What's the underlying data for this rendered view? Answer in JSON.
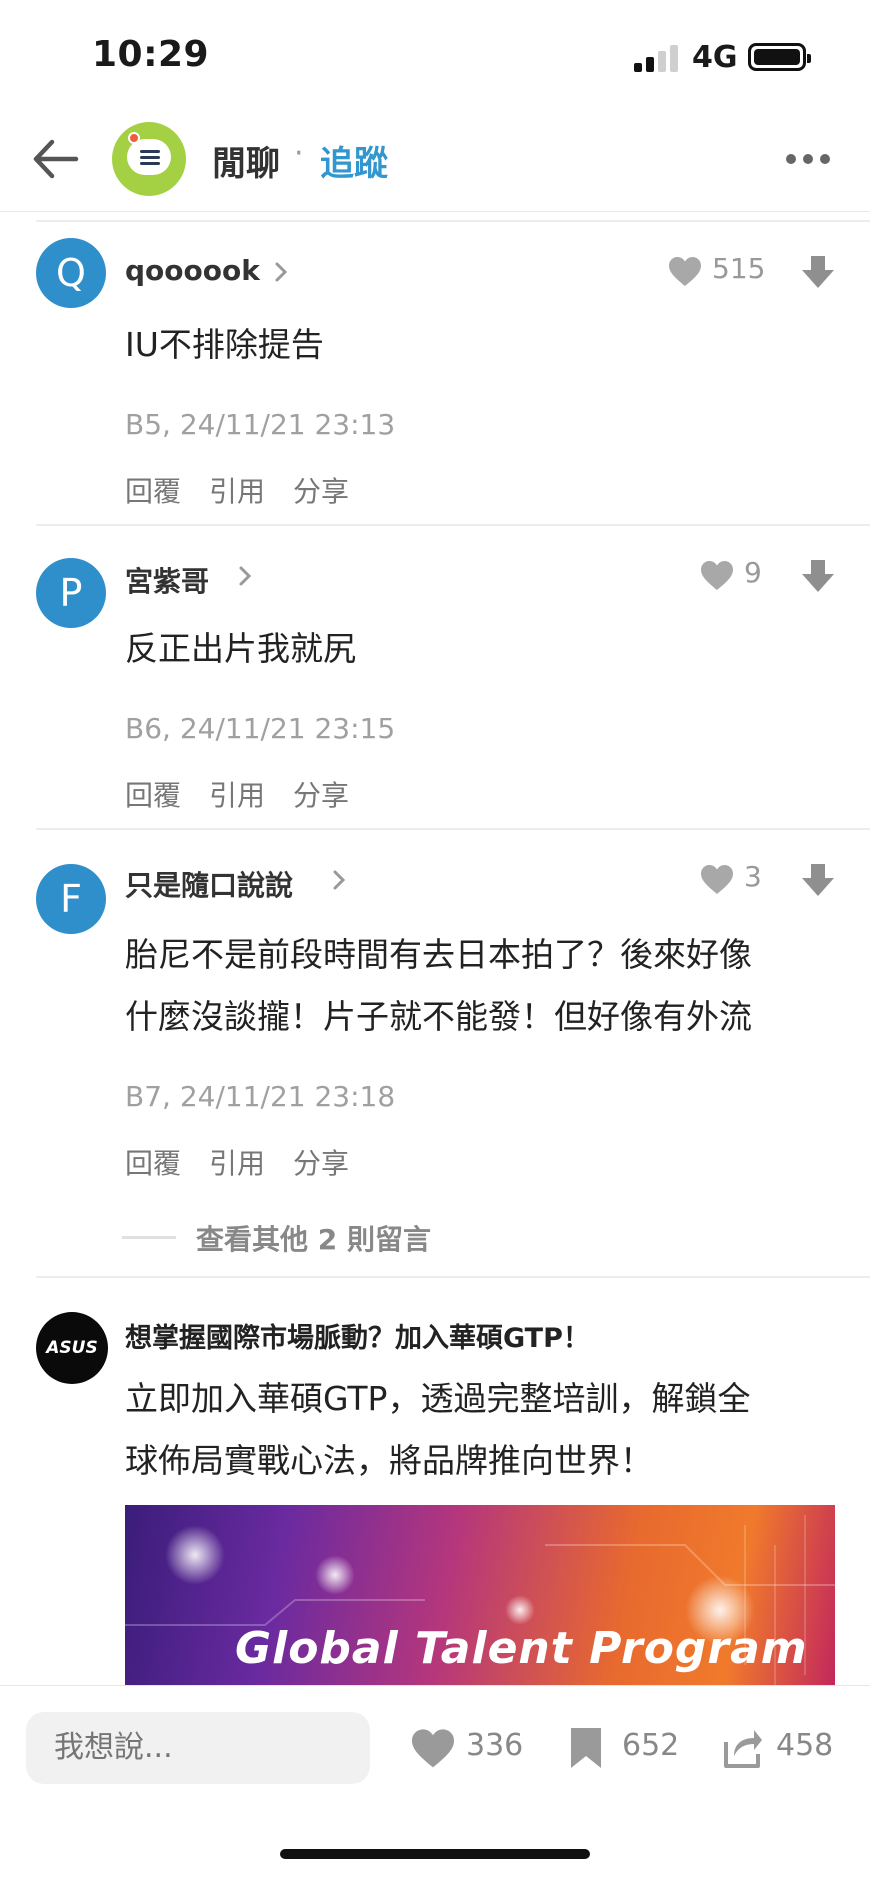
{
  "status_bar": {
    "time": "10:29",
    "network": "4G"
  },
  "header": {
    "board_name": "閒聊",
    "separator": "·",
    "follow_label": "追蹤"
  },
  "comments": [
    {
      "avatar_letter": "Q",
      "username": "qoooook",
      "likes": "515",
      "content_lines": [
        "IU不排除提告"
      ],
      "meta": "B5, 24/11/21 23:13"
    },
    {
      "avatar_letter": "P",
      "username": "宮紫哥",
      "likes": "9",
      "content_lines": [
        "反正出片我就尻"
      ],
      "meta": "B6, 24/11/21 23:15"
    },
    {
      "avatar_letter": "F",
      "username": "只是隨口說說",
      "likes": "3",
      "content_lines": [
        "胎尼不是前段時間有去日本拍了？後來好像",
        "什麼沒談攏！片子就不能發！但好像有外流"
      ],
      "meta": "B7, 24/11/21 23:18"
    }
  ],
  "comment_actions": {
    "reply": "回覆",
    "quote": "引用",
    "share": "分享"
  },
  "more_replies": "查看其他 2 則留言",
  "ad": {
    "logo_text": "ASUS",
    "title": "想掌握國際市場脈動？加入華碩GTP！",
    "body_lines": [
      "立即加入華碩GTP，透過完整培訓，解鎖全",
      "球佈局實戰心法，將品牌推向世界！"
    ],
    "banner_text": "Global Talent Program"
  },
  "bottom_bar": {
    "input_placeholder": "我想說...",
    "likes": "336",
    "bookmarks": "652",
    "shares": "458"
  },
  "colors": {
    "accent": "#3397cf",
    "avatar": "#2f8fcb",
    "board_icon": "#a3d143"
  }
}
